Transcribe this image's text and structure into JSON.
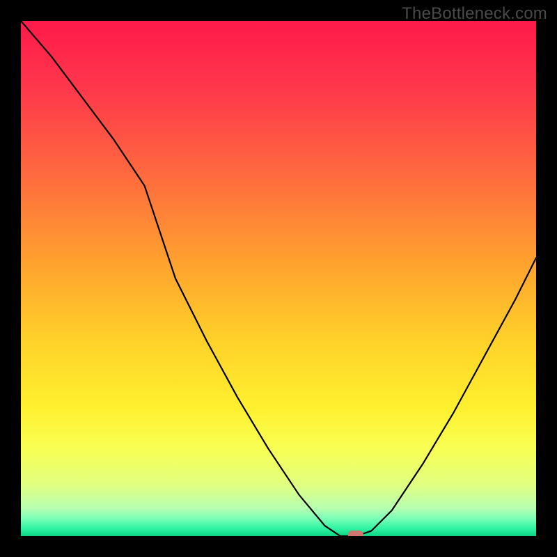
{
  "watermark": "TheBottleneck.com",
  "chart_data": {
    "type": "line",
    "title": "",
    "xlabel": "",
    "ylabel": "",
    "xlim": [
      0,
      100
    ],
    "ylim": [
      0,
      100
    ],
    "x": [
      0,
      6,
      12,
      18,
      24,
      30,
      36,
      42,
      48,
      54,
      59,
      62,
      65,
      68,
      72,
      78,
      84,
      90,
      96,
      100
    ],
    "values": [
      100,
      93,
      85,
      77,
      68,
      50,
      38,
      27,
      17,
      8,
      2,
      0,
      0,
      1,
      5,
      14,
      24,
      35,
      46,
      54
    ],
    "marker": {
      "x": 65,
      "y": 0,
      "color": "#d1776d"
    },
    "gradient_stops": [
      {
        "offset": 0,
        "color": "#ff1a4a"
      },
      {
        "offset": 0.14,
        "color": "#ff3a4b"
      },
      {
        "offset": 0.3,
        "color": "#ff6a3e"
      },
      {
        "offset": 0.47,
        "color": "#ffa22e"
      },
      {
        "offset": 0.62,
        "color": "#ffd129"
      },
      {
        "offset": 0.75,
        "color": "#fff02e"
      },
      {
        "offset": 0.83,
        "color": "#f8ff54"
      },
      {
        "offset": 0.9,
        "color": "#e1ff80"
      },
      {
        "offset": 0.945,
        "color": "#b8ffb0"
      },
      {
        "offset": 0.965,
        "color": "#7effb8"
      },
      {
        "offset": 0.985,
        "color": "#30f3a3"
      },
      {
        "offset": 1.0,
        "color": "#0bd583"
      }
    ]
  }
}
